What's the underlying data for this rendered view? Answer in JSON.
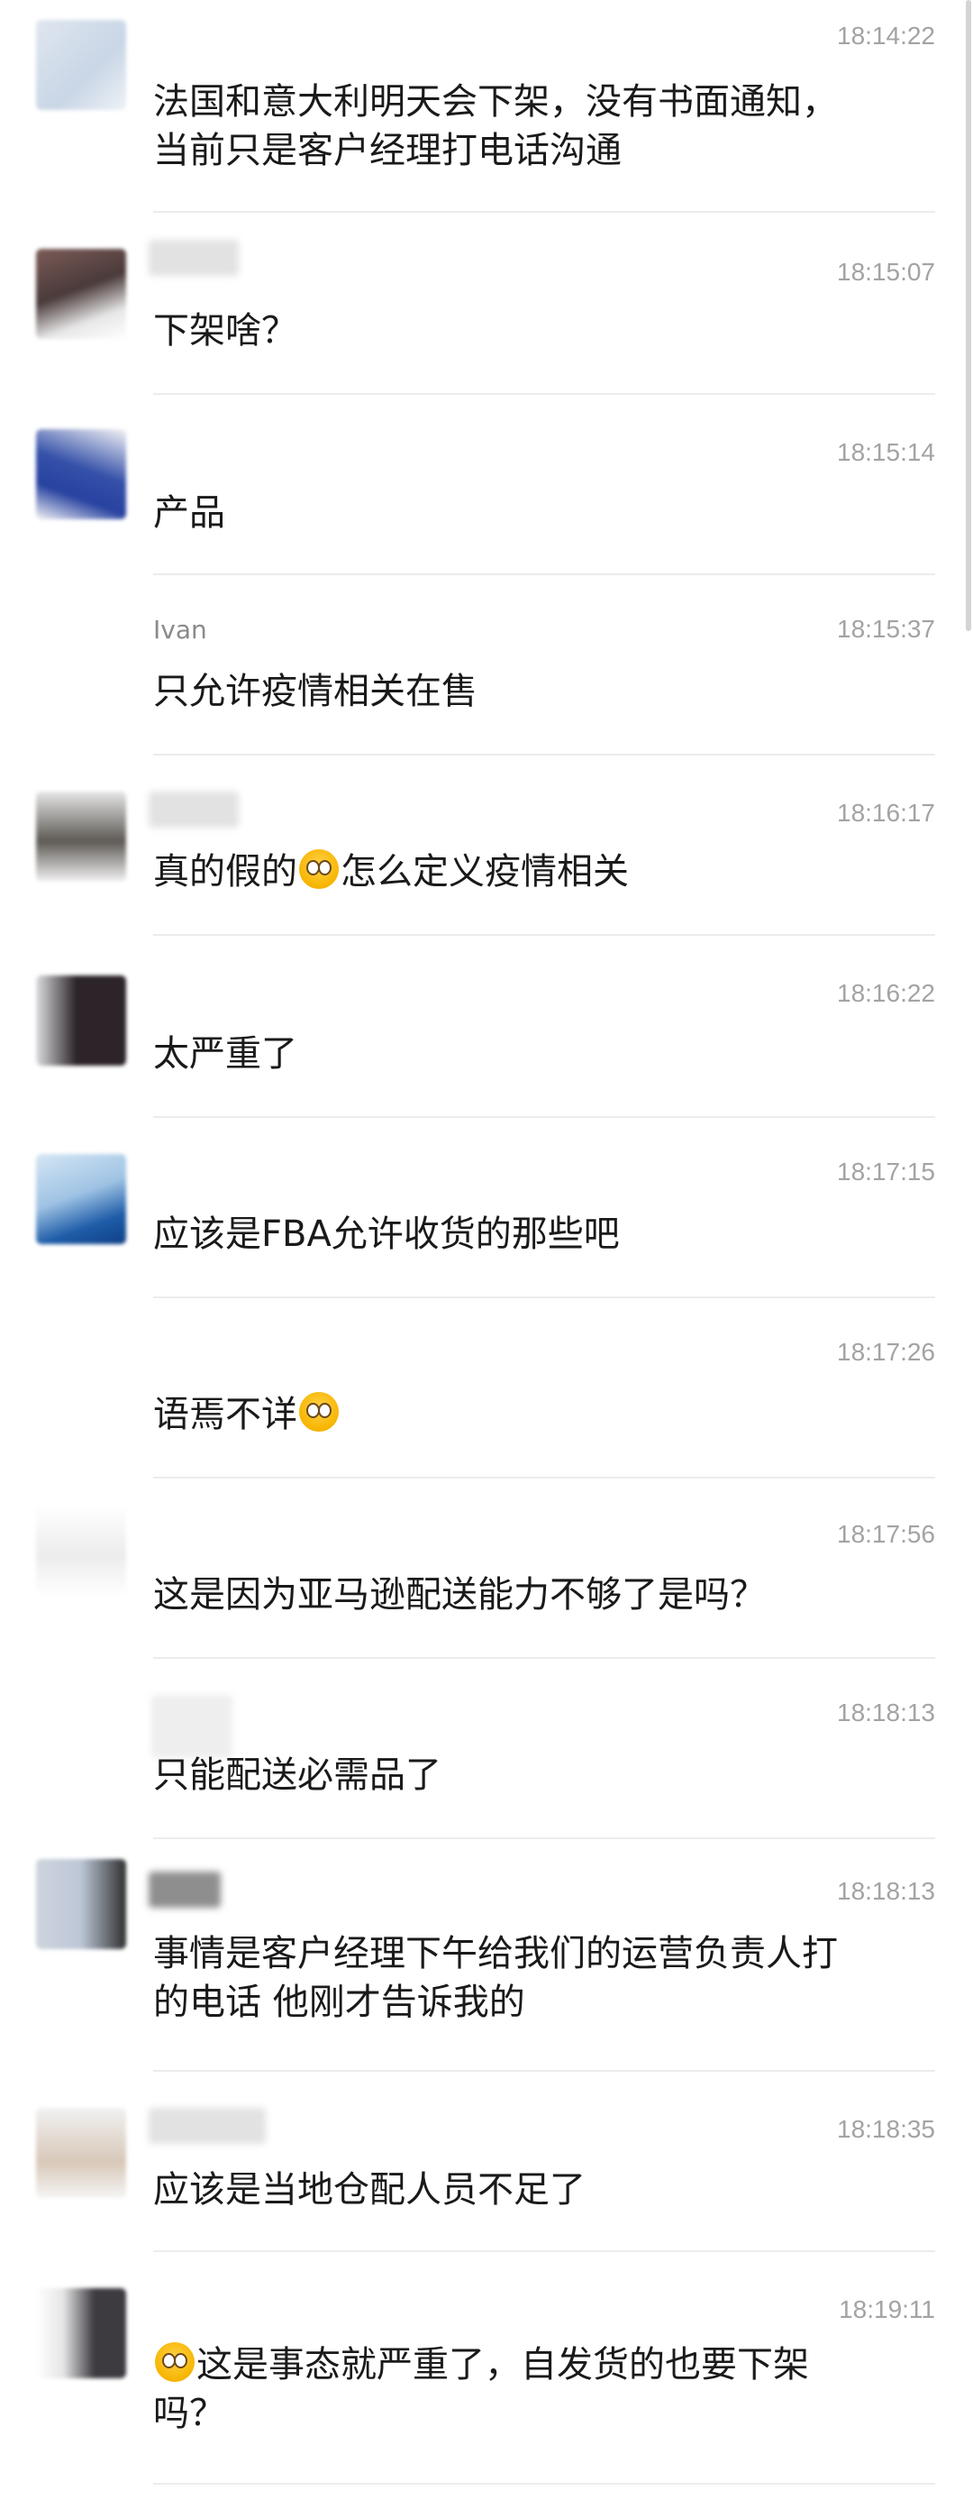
{
  "messages": [
    {
      "sender": "",
      "time": "18:14:22",
      "lines": [
        "法国和意大利明天会下架，没有书面通知，",
        "当前只是客户经理打电话沟通"
      ]
    },
    {
      "sender": "",
      "time": "18:15:07",
      "lines": [
        "下架啥？"
      ]
    },
    {
      "sender": "",
      "time": "18:15:14",
      "lines": [
        "产品"
      ]
    },
    {
      "sender": "Ivan",
      "time": "18:15:37",
      "lines": [
        "只允许疫情相关在售"
      ]
    },
    {
      "sender": "",
      "time": "18:16:17",
      "lines_pre": "真的假的",
      "lines_post": "怎么定义疫情相关"
    },
    {
      "sender": "",
      "time": "18:16:22",
      "lines": [
        "太严重了"
      ]
    },
    {
      "sender": "",
      "time": "18:17:15",
      "lines": [
        "应该是FBA允许收货的那些吧"
      ]
    },
    {
      "sender": "",
      "time": "18:17:26",
      "lines_pre": "语焉不详",
      "lines_post": ""
    },
    {
      "sender": "",
      "time": "18:17:56",
      "lines": [
        "这是因为亚马逊配送能力不够了是吗？"
      ]
    },
    {
      "sender": "",
      "time": "18:18:13",
      "lines": [
        "只能配送必需品了"
      ]
    },
    {
      "sender": "",
      "time": "18:18:13",
      "lines": [
        "事情是客户经理下午给我们的运营负责人打",
        "的电话 他刚才告诉我的"
      ]
    },
    {
      "sender": "",
      "time": "18:18:35",
      "lines": [
        "应该是当地仓配人员不足了"
      ]
    },
    {
      "sender": "",
      "time": "18:19:11",
      "lines_post": "这是事态就严重了，自发货的也要下架",
      "line2": "吗？"
    }
  ]
}
